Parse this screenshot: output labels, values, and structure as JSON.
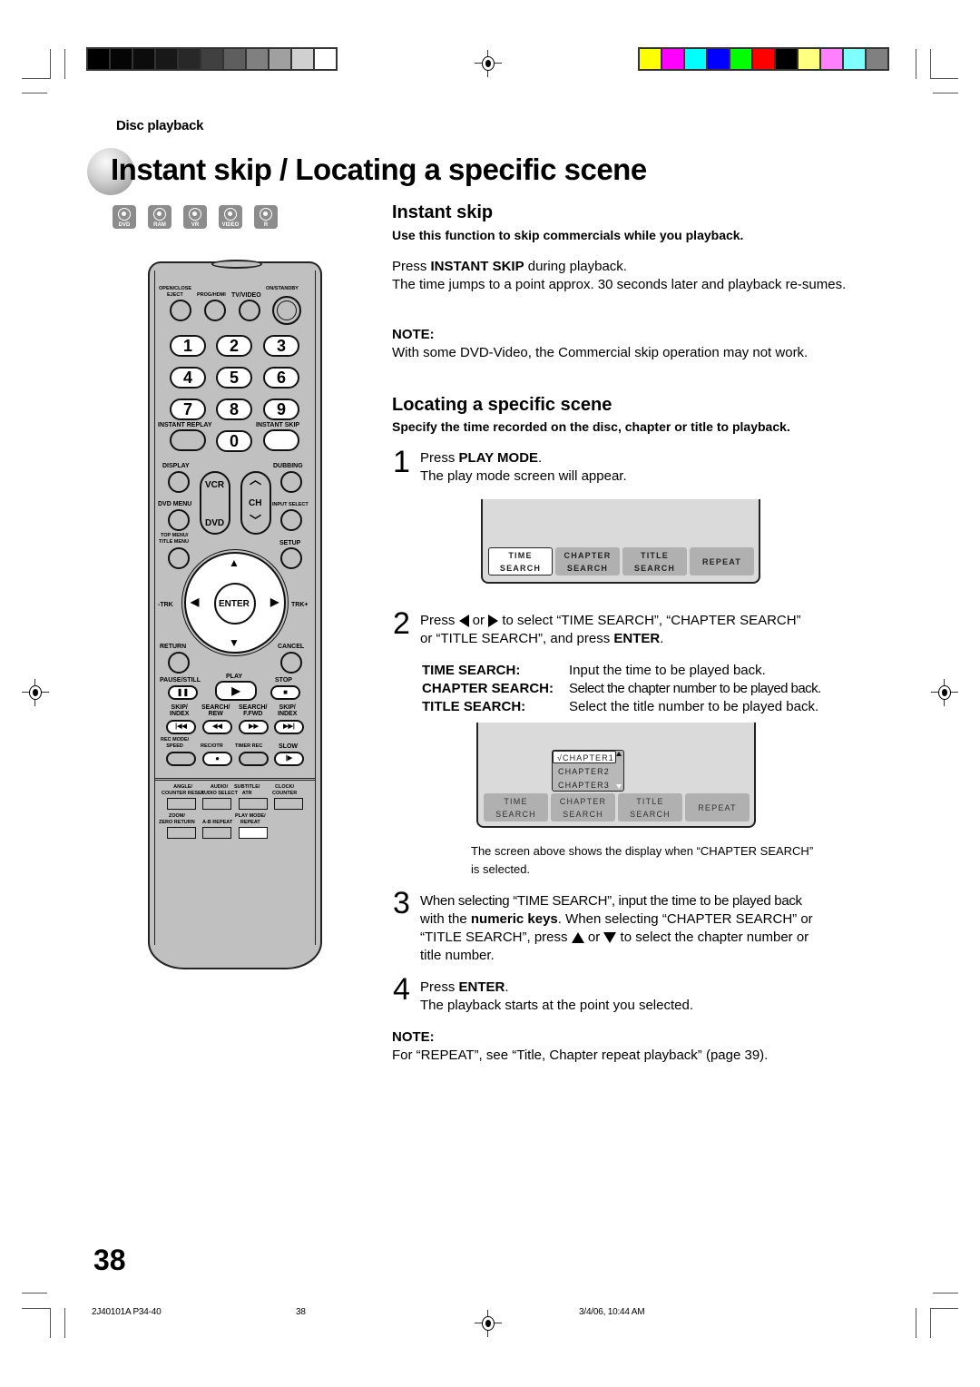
{
  "header": {
    "section_label": "Disc playback",
    "page_title": "Instant skip / Locating a specific scene",
    "grayscale_bar": [
      "#000000",
      "#050505",
      "#0c0c0c",
      "#181818",
      "#282828",
      "#404040",
      "#5e5e5e",
      "#808080",
      "#a0a0a0",
      "#d0d0d0",
      "#ffffff"
    ],
    "color_bar": [
      "#ffff00",
      "#ff00ff",
      "#00ffff",
      "#0000ff",
      "#00ff00",
      "#ff0000",
      "#000000",
      "#ffff80",
      "#ff80ff",
      "#80ffff",
      "#808080"
    ]
  },
  "disc_icons": [
    {
      "name": "dvd-icon",
      "label": "DVD"
    },
    {
      "name": "ram-icon",
      "label": "RAM"
    },
    {
      "name": "vr-icon",
      "label": "VR"
    },
    {
      "name": "video-icon",
      "label": "VIDEO"
    },
    {
      "name": "r-icon",
      "label": "R"
    }
  ],
  "remote": {
    "open_close": "OPEN/CLOSE",
    "eject": "EJECT",
    "prog_hdmi": "PROG/HDMI",
    "tv_video": "TV/VIDEO",
    "on_standby": "ON/STANDBY",
    "digits": [
      "1",
      "2",
      "3",
      "4",
      "5",
      "6",
      "7",
      "8",
      "9",
      "0"
    ],
    "instant_replay": "INSTANT REPLAY",
    "instant_skip": "INSTANT SKIP",
    "display": "DISPLAY",
    "dubbing": "DUBBING",
    "vcr": "VCR",
    "dvd": "DVD",
    "ch": "CH",
    "dvd_menu": "DVD MENU",
    "input_select": "INPUT SELECT",
    "top_menu": "TOP MENU/",
    "title_menu": "TITLE MENU",
    "setup": "SETUP",
    "trk_minus": "-TRK",
    "trk_plus": "TRK+",
    "enter": "ENTER",
    "return": "RETURN",
    "cancel": "CANCEL",
    "pause_still": "PAUSE/STILL",
    "play": "PLAY",
    "stop": "STOP",
    "skip_index_l1": "SKIP/",
    "skip_index_l2": "INDEX",
    "search_rew_l1": "SEARCH/",
    "search_rew_l2": "REW",
    "search_ffwd_l1": "SEARCH/",
    "search_ffwd_l2": "F.FWD",
    "rec_mode_l1": "REC MODE/",
    "rec_mode_l2": "SPEED",
    "rec_otr": "REC/OTR",
    "timer_rec": "TIMER REC",
    "slow": "SLOW",
    "angle_l1": "ANGLE/",
    "angle_l2": "COUNTER RESET",
    "audio_l1": "AUDIO/",
    "audio_l2": "AUDIO SELECT",
    "subtitle_l1": "SUBTITLE/",
    "subtitle_l2": "ATR",
    "clock_l1": "CLOCK/",
    "clock_l2": "COUNTER",
    "zoom_l1": "ZOOM/",
    "zoom_l2": "ZERO RETURN",
    "ab_repeat": "A-B REPEAT",
    "play_mode_l1": "PLAY MODE/",
    "play_mode_l2": "REPEAT"
  },
  "instant_skip": {
    "heading": "Instant skip",
    "subheading": "Use this function to skip commercials while you playback.",
    "press_prefix": "Press ",
    "press_bold": "INSTANT SKIP",
    "press_suffix": " during playback.",
    "body": "The time jumps to a point approx. 30 seconds later and playback re-sumes.",
    "note_label": "NOTE:",
    "note_text": "With some DVD-Video, the Commercial skip operation may not work."
  },
  "locating": {
    "heading": "Locating a specific scene",
    "subheading": "Specify the time recorded on the disc, chapter or title to playback.",
    "steps": [
      {
        "num": "1",
        "prefix": "Press ",
        "bold": "PLAY MODE",
        "suffix": ".",
        "line2": "The play mode screen will appear."
      },
      {
        "num": "2",
        "line1a": "Press ",
        "line1b": " or ",
        "line1c": " to select “TIME SEARCH”, “CHAPTER SEARCH”",
        "line2a": "or “TITLE SEARCH”, and press ",
        "line2b": "ENTER",
        "line2c": "."
      },
      {
        "num": "3",
        "l1": "When selecting “TIME SEARCH”, input the time to be played back",
        "l2a": "with the ",
        "l2b": "numeric keys",
        "l2c": ". When selecting “CHAPTER SEARCH” or",
        "l3a": "“TITLE SEARCH”, press ",
        "l3b": " or ",
        "l3c": " to select the chapter number or",
        "l4": "title number."
      },
      {
        "num": "4",
        "prefix": "Press ",
        "bold": "ENTER",
        "suffix": ".",
        "line2": "The playback starts at the point you selected."
      }
    ],
    "search_terms": [
      {
        "term": "TIME SEARCH:",
        "def": "Input the time to be played back."
      },
      {
        "term": "CHAPTER SEARCH:",
        "def": "Select the chapter number to be played back."
      },
      {
        "term": "TITLE SEARCH:",
        "def": "Select the title number to be played back."
      }
    ],
    "screen1_tabs": [
      {
        "l1": "TIME",
        "l2": "SEARCH",
        "selected": true
      },
      {
        "l1": "CHAPTER",
        "l2": "SEARCH",
        "selected": false
      },
      {
        "l1": "TITLE",
        "l2": "SEARCH",
        "selected": false
      },
      {
        "l1": "REPEAT",
        "l2": "",
        "selected": false
      }
    ],
    "screen2_tabs": [
      {
        "l1": "TIME",
        "l2": "SEARCH"
      },
      {
        "l1": "CHAPTER",
        "l2": "SEARCH"
      },
      {
        "l1": "TITLE",
        "l2": "SEARCH"
      },
      {
        "l1": "REPEAT",
        "l2": ""
      }
    ],
    "chapter_options": [
      "√CHAPTER1",
      "CHAPTER2",
      "CHAPTER3"
    ],
    "caption_l1": "The screen above shows the display when “CHAPTER SEARCH”",
    "caption_l2": "is selected.",
    "note_label": "NOTE:",
    "note_text": "For “REPEAT”, see “Title, Chapter repeat playback” (page 39)."
  },
  "page_number": "38",
  "footer": {
    "doc_code": "2J40101A P34-40",
    "page": "38",
    "datetime": "3/4/06, 10:44 AM"
  }
}
